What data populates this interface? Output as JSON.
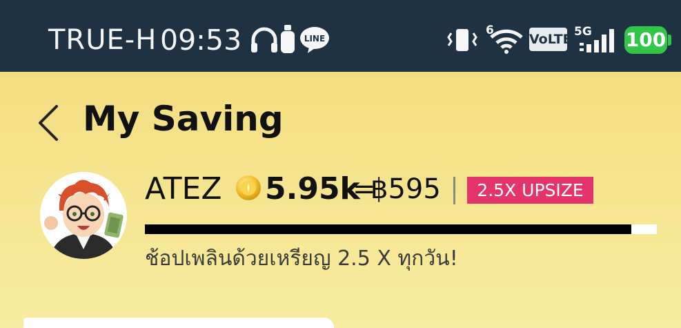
{
  "status_bar": {
    "carrier": "TRUE-H",
    "time": "09:53",
    "wifi_badge": "6",
    "volte": "VoLTE",
    "network": "5G",
    "battery": "100",
    "icons": [
      "headphones-icon",
      "earbuds-icon",
      "line-app-icon",
      "vibrate-icon",
      "wifi-icon",
      "signal-icon",
      "battery-icon"
    ]
  },
  "header": {
    "title": "My Saving",
    "back_icon": "chevron-left-icon"
  },
  "profile": {
    "name": "ATEZ",
    "coin_amount": "5.95k",
    "equals": "=",
    "baht_value": "฿595",
    "badge": "2.5X UPSIZE",
    "badge_color": "#e3356b",
    "progress_fraction": 0.95,
    "promo": "ช้อปเพลินด้วยเหรียญ 2.5 X ทุกวัน!"
  },
  "colors": {
    "status_bar_bg": "#1f3244",
    "header_bg": "#f2d877",
    "battery": "#33c44a"
  }
}
